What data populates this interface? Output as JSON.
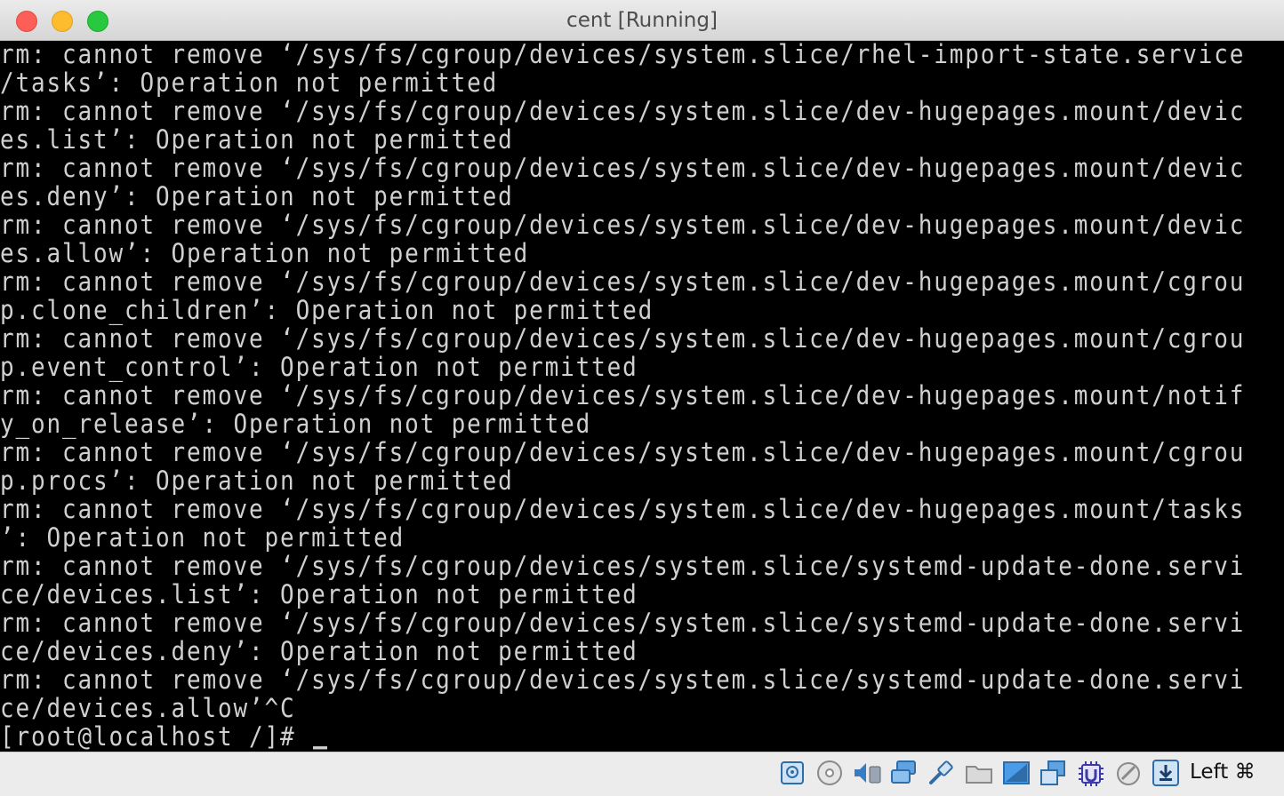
{
  "window": {
    "title": "cent [Running]"
  },
  "terminal": {
    "lines": [
      "rm: cannot remove ‘/sys/fs/cgroup/devices/system.slice/rhel-import-state.service",
      "/tasks’: Operation not permitted",
      "rm: cannot remove ‘/sys/fs/cgroup/devices/system.slice/dev-hugepages.mount/devic",
      "es.list’: Operation not permitted",
      "rm: cannot remove ‘/sys/fs/cgroup/devices/system.slice/dev-hugepages.mount/devic",
      "es.deny’: Operation not permitted",
      "rm: cannot remove ‘/sys/fs/cgroup/devices/system.slice/dev-hugepages.mount/devic",
      "es.allow’: Operation not permitted",
      "rm: cannot remove ‘/sys/fs/cgroup/devices/system.slice/dev-hugepages.mount/cgrou",
      "p.clone_children’: Operation not permitted",
      "rm: cannot remove ‘/sys/fs/cgroup/devices/system.slice/dev-hugepages.mount/cgrou",
      "p.event_control’: Operation not permitted",
      "rm: cannot remove ‘/sys/fs/cgroup/devices/system.slice/dev-hugepages.mount/notif",
      "y_on_release’: Operation not permitted",
      "rm: cannot remove ‘/sys/fs/cgroup/devices/system.slice/dev-hugepages.mount/cgrou",
      "p.procs’: Operation not permitted",
      "rm: cannot remove ‘/sys/fs/cgroup/devices/system.slice/dev-hugepages.mount/tasks",
      "’: Operation not permitted",
      "rm: cannot remove ‘/sys/fs/cgroup/devices/system.slice/systemd-update-done.servi",
      "ce/devices.list’: Operation not permitted",
      "rm: cannot remove ‘/sys/fs/cgroup/devices/system.slice/systemd-update-done.servi",
      "ce/devices.deny’: Operation not permitted",
      "rm: cannot remove ‘/sys/fs/cgroup/devices/system.slice/systemd-update-done.servi",
      "ce/devices.allow’^C"
    ],
    "prompt": "[root@localhost /]# "
  },
  "statusbar": {
    "icons": [
      "hard-disk-icon",
      "optical-drive-icon",
      "audio-icon",
      "network-icon",
      "usb-icon",
      "shared-folders-icon",
      "display-icon",
      "video-capture-icon",
      "cpu-icon",
      "mouse-integration-icon",
      "keyboard-capture-icon"
    ],
    "host_key_label": "Left ⌘"
  }
}
